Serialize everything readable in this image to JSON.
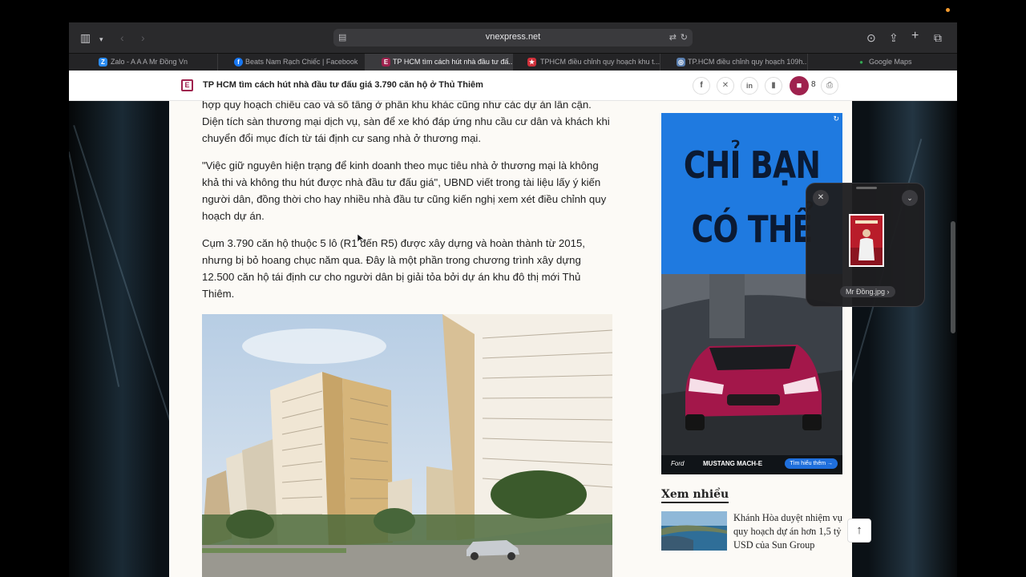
{
  "browser": {
    "url": "vnexpress.net",
    "tabs": [
      {
        "label": "Zalo - A A A Mr Đồng Vn",
        "favicon": "Z",
        "color": "#2b8cf2",
        "active": false
      },
      {
        "label": "Beats Nam Rạch Chiếc | Facebook",
        "favicon": "f",
        "color": "#1877f2",
        "active": false
      },
      {
        "label": "TP HCM tìm cách hút nhà đầu tư đấ...",
        "favicon": "E",
        "color": "#9f224e",
        "active": true
      },
      {
        "label": "TPHCM điều chỉnh quy hoạch khu t...",
        "favicon": "★",
        "color": "#d0303a",
        "active": false
      },
      {
        "label": "TP.HCM điều chỉnh quy hoạch 109h...",
        "favicon": "◎",
        "color": "#5a7fb0",
        "active": false
      },
      {
        "label": "Google Maps",
        "favicon": "●",
        "color": "#34a853",
        "active": false
      }
    ]
  },
  "site_header": {
    "title": "TP HCM tìm cách hút nhà đầu tư đấu giá 3.790 căn hộ ở Thủ Thiêm",
    "comment_count": "8"
  },
  "article": {
    "paragraphs": [
      "hợp quy hoạch chiều cao và số tầng ở phân khu khác cũng như các dự án lân cận. Diện tích sàn thương mại dịch vụ, sàn để xe khó đáp ứng nhu cầu cư dân và khách khi chuyển đổi mục đích từ tái định cư sang nhà ở thương mại.",
      "\"Việc giữ nguyên hiện trạng để kinh doanh theo mục tiêu nhà ở thương mại là không khả thi và không thu hút được nhà đầu tư đấu giá\", UBND viết trong tài liệu lấy ý kiến người dân, đồng thời cho hay nhiều nhà đầu tư cũng kiến nghị xem xét điều chỉnh quy hoạch dự án.",
      "Cụm 3.790 căn hộ thuộc 5 lô (R1 đến R5) được xây dựng và hoàn thành từ 2015, nhưng bị bỏ hoang chục năm qua. Đây là một phần trong chương trình xây dựng 12.500 căn hộ tái định cư cho người dân bị giải tỏa bởi dự án khu đô thị mới Thủ Thiêm."
    ]
  },
  "ad": {
    "headline_line1": "CHỈ BẠN",
    "headline_line2": "CÓ THỂ",
    "brand": "Ford",
    "model": "MUSTANG MACH-E",
    "cta": "Tìm hiểu thêm →"
  },
  "sidebar": {
    "most_read_title": "Xem nhiều",
    "items": [
      {
        "title": "Khánh Hòa duyệt nhiệm vụ quy hoạch dự án hơn 1,5 tỷ USD của Sun Group"
      }
    ]
  },
  "download_popover": {
    "filename": "Mr Đồng.jpg"
  }
}
